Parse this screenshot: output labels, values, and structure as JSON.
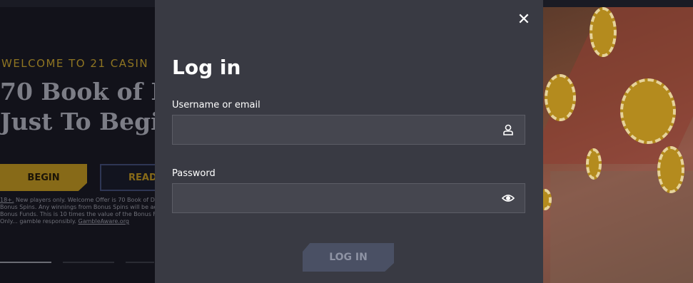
{
  "background": {
    "welcome": "WELCOME TO 21 CASIN",
    "headline_line1": "70 Book of D",
    "headline_line2": "Just To Begi",
    "begin_label": "BEGIN",
    "read_label": "READ",
    "terms_link": "18+.",
    "terms_text": " New players only. Welcome Offer is 70 Book of Dead Bonus Spins. Any winnings from Bonus Spins will be added as Bonus Funds. This is 10 times the value of the Bonus Funds. Only... gamble responsibly. ",
    "gamble_aware": "GambleAware.org"
  },
  "modal": {
    "title": "Log in",
    "close_symbol": "✕",
    "username_label": "Username or email",
    "username_value": "",
    "username_placeholder": "",
    "password_label": "Password",
    "password_value": "",
    "password_placeholder": "",
    "submit_label": "LOG IN"
  },
  "icons": {
    "username": "user-icon",
    "password": "eye-icon"
  },
  "colors": {
    "modal_bg": "#393a43",
    "gold_accent": "#876a18",
    "submit_bg": "#4a5064"
  }
}
